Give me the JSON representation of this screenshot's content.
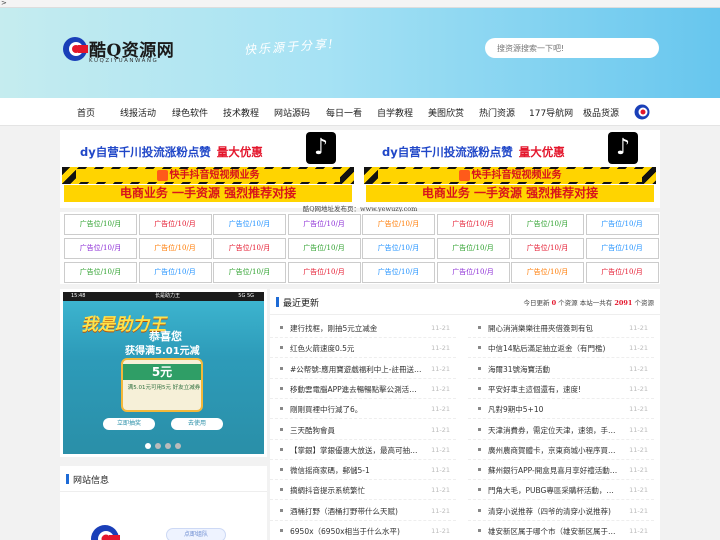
{
  "page": {
    "arrow": ">"
  },
  "header": {
    "logo_title": "酷Q资源网",
    "logo_sub": "KUQZIYUANWANG",
    "slogan": "快乐源于分享!",
    "search_placeholder": "搜资源搜索一下吧!"
  },
  "nav": {
    "items": [
      "首页",
      "线报活动",
      "绿色软件",
      "技术教程",
      "网站源码",
      "每日一看",
      "自学教程",
      "美图欣赏",
      "热门资源",
      "177导航网",
      "极品货源"
    ]
  },
  "banners": [
    {
      "line1_blue": "dy自营千川投流涨粉点赞",
      "line1_red": "量大优惠",
      "stripe": "快手抖音短视频业务",
      "line2": "电商业务 一手资源 强烈推荐对接",
      "icon": "♪"
    },
    {
      "line1_blue": "dy自营千川投流涨粉点赞",
      "line1_red": "量大优惠",
      "stripe": "快手抖音短视频业务",
      "line2": "电商业务 一手资源 强烈推荐对接",
      "icon": "♪"
    }
  ],
  "caption": "酷Q网地址发布页：www.yewuzy.com",
  "ads": {
    "label": "广告位/10/月",
    "colors": [
      "#2ca02c",
      "#e4162c",
      "#1e90ff",
      "#8b2bd6",
      "#ff7a00",
      "#e4162c",
      "#2ca02c",
      "#1e90ff"
    ]
  },
  "slider": {
    "status_time": "15:48",
    "status_mid": "长是助力王",
    "status_right": "5G 5G",
    "title": "我是助力王",
    "sub1": "恭喜您",
    "sub2": "获得满5.01元减",
    "coupon_amount": "5元",
    "coupon_text": "满5.01元可用5元 好友立减券",
    "btn_left": "立即抽奖",
    "btn_right": "去使用"
  },
  "siteinfo": {
    "title": "网站信息",
    "button": "点即组队"
  },
  "latest": {
    "title": "最近更新",
    "stats_prefix": "今日更新",
    "today": "0",
    "stats_mid": "个资源 本站一共有",
    "total": "2091",
    "stats_suffix": "个资源",
    "left": [
      {
        "text": "建行找框，刚抽5元立减金",
        "date": "11-21"
      },
      {
        "text": "红色火箭速度0.5元",
        "date": "11-21"
      },
      {
        "text": "#公帮號:應用寶遊戲福利中上-註冊送1k…",
        "date": "11-21"
      },
      {
        "text": "移動雲電腦APP進去暢暢點擊公測活動…",
        "date": "11-21"
      },
      {
        "text": "剛剛買裡中行減了6。",
        "date": "11-21"
      },
      {
        "text": "三天酷狗會員",
        "date": "11-21"
      },
      {
        "text": "【掌銀】掌銀優惠大放送，最高可抽微…",
        "date": "11-21"
      },
      {
        "text": "微信摇商家碼，郵儲5-1",
        "date": "11-21"
      },
      {
        "text": "摘綢抖音提示系統繁忙",
        "date": "11-21"
      },
      {
        "text": "酒桶打野（酒桶打野带什么天赋)",
        "date": "11-21"
      },
      {
        "text": "6950x（6950x相当于什么水平)",
        "date": "11-21"
      }
    ],
    "right": [
      {
        "text": "開心消消樂樂往冊夾借簽到有包",
        "date": "11-21"
      },
      {
        "text": "中信14點后滿足抽立返金（有門檻)",
        "date": "11-21"
      },
      {
        "text": "海爾31號海寶活動",
        "date": "11-21"
      },
      {
        "text": "平安好車主這個還有，速度!",
        "date": "11-21"
      },
      {
        "text": "凡對9期中5+10",
        "date": "11-21"
      },
      {
        "text": "天津消費券，需定位天津，速領，手慢…",
        "date": "11-21"
      },
      {
        "text": "廣州農商賀體卡，京東商城小程序買京…",
        "date": "11-21"
      },
      {
        "text": "蘇州銀行APP-開盒見喜月享好禮活動開…",
        "date": "11-21"
      },
      {
        "text": "門角大毛，PUBG專區采購杯活動，綁…",
        "date": "11-21"
      },
      {
        "text": "清穿小说推荐（四爷的清穿小说推荐)",
        "date": "11-21"
      },
      {
        "text": "雄安新区属于哪个市（雄安新区属于保…",
        "date": "11-21"
      }
    ]
  }
}
